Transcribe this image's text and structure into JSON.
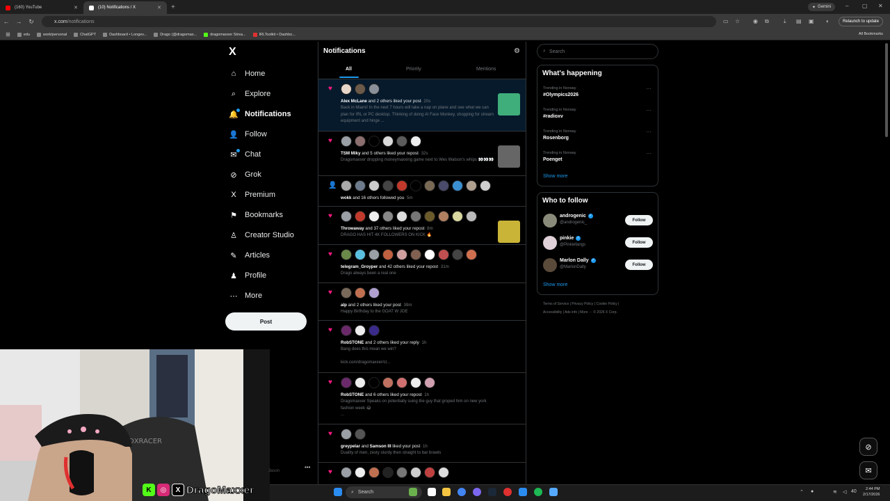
{
  "browser": {
    "tabs": [
      {
        "title": "(160) YouTube",
        "favicon_color": "#ff0000"
      },
      {
        "title": "(10) Notifications / X",
        "favicon_color": "#ffffff"
      }
    ],
    "new_tab_label": "+",
    "gemini_label": "Gemini",
    "url_domain": "x.com",
    "url_path": "/notifications",
    "relaunch_label": "Relaunch to update",
    "bookmarks": [
      "edu",
      "work/personal",
      "ChatGPT",
      "Dashboard • Longev...",
      "Drago (@dragomax...",
      "dragomaxxer Strea...",
      "IRLToolkit • Dashbo..."
    ],
    "all_bookmarks": "All Bookmarks"
  },
  "sidebar": {
    "logo": "X",
    "items": [
      {
        "label": "Home",
        "icon": "home-icon",
        "glyph": "⌂"
      },
      {
        "label": "Explore",
        "icon": "search-icon",
        "glyph": "⌕"
      },
      {
        "label": "Notifications",
        "icon": "bell-icon",
        "glyph": "🔔"
      },
      {
        "label": "Follow",
        "icon": "follow-icon",
        "glyph": "👤"
      },
      {
        "label": "Chat",
        "icon": "chat-icon",
        "glyph": "✉"
      },
      {
        "label": "Grok",
        "icon": "grok-icon",
        "glyph": "⊘"
      },
      {
        "label": "Premium",
        "icon": "x-premium-icon",
        "glyph": "X"
      },
      {
        "label": "Bookmarks",
        "icon": "bookmark-icon",
        "glyph": "⚑"
      },
      {
        "label": "Creator Studio",
        "icon": "creator-studio-icon",
        "glyph": "♙"
      },
      {
        "label": "Articles",
        "icon": "articles-icon",
        "glyph": "✎"
      },
      {
        "label": "Profile",
        "icon": "profile-icon",
        "glyph": "♟"
      },
      {
        "label": "More",
        "icon": "more-icon",
        "glyph": "⋯"
      }
    ],
    "post_label": "Post",
    "account_more": "•••"
  },
  "notifications": {
    "title": "Notifications",
    "tabs": [
      "All",
      "Priority",
      "Mentions"
    ],
    "items": [
      {
        "type": "like",
        "actor": "Alex McLane",
        "rest": " and 2 others liked your post",
        "time": "· 20s",
        "body": "Back in Miami! In the next 7 hours will take a nap on plane and see what we can plan for IRL or PC desktop. Thinking of doing AI Face Monkey, shopping for stream equipment and hinge ...",
        "avatars": [
          "#e8d6c8",
          "#6b5a4a",
          "#8a9099"
        ],
        "thumb": true,
        "thumb_color": "#3fae7a",
        "highlight": true
      },
      {
        "type": "like",
        "actor": "TSM Miky",
        "rest": " and 5 others liked your repost",
        "time": "· 32s",
        "body": "Dragomaxxer dropping moneymaxxing game next to Wes Watson's whips 👀👀👀",
        "avatars": [
          "#9aa0a6",
          "#8c6e6e",
          "#000000",
          "#d9d9d9",
          "#5c5c5c",
          "#eeeeee"
        ],
        "thumb": true,
        "thumb_color": "#666666"
      },
      {
        "type": "follow",
        "actor": "wokk",
        "rest": " and 16 others followed you",
        "time": "· 5m",
        "body": "",
        "avatars": [
          "#aaaaaa",
          "#6d7b8c",
          "#cccccc",
          "#444444",
          "#c0392b",
          "#000000",
          "#7a6a55",
          "#4a4a6a",
          "#3a8fd0",
          "#b0a090",
          "#cfcfcf"
        ],
        "thumb": false
      },
      {
        "type": "like",
        "actor": "Throwaway",
        "rest": " and 37 others liked your repost",
        "time": "· 8m",
        "body": "DRAGO HAS HIT 4K FOLLOWERS ON KICK 🔥",
        "avatars": [
          "#9aa0a6",
          "#c0392b",
          "#eeeeee",
          "#888888",
          "#dddddd",
          "#777777",
          "#6b5a2a",
          "#b08060",
          "#d8d8a0",
          "#bbbbbb"
        ],
        "thumb": true,
        "thumb_color": "#c9b437"
      },
      {
        "type": "like",
        "actor": "telegram_Groyper",
        "rest": " and 42 others liked your repost",
        "time": "· 31m",
        "body": "Drago always been a real one",
        "avatars": [
          "#6a8a4a",
          "#5ac0e0",
          "#9aa0a6",
          "#c06040",
          "#d0a0a0",
          "#806050",
          "#ffffff",
          "#c05050",
          "#444444",
          "#d07050"
        ],
        "thumb": false
      },
      {
        "type": "like",
        "actor": "alp",
        "rest": " and 2 others liked your post",
        "time": "· 39m",
        "body": "Happy Birthday to the GOAT W JOE",
        "avatars": [
          "#7a6a5a",
          "#c07050",
          "#b0a0d0"
        ],
        "thumb": false
      },
      {
        "type": "like",
        "actor": "RobSTONE",
        "rest": " and 2 others liked your reply",
        "time": "· 1h",
        "body": "Bang does this mean we win?",
        "link": "kick.com/dragomaxxer/cl...",
        "avatars": [
          "#6a2a6a",
          "#eeeeee",
          "#3a2a8a"
        ],
        "thumb": false
      },
      {
        "type": "like",
        "actor": "RobSTONE",
        "rest": " and 6 others liked your repost",
        "time": "· 1h",
        "body": "Dragomaxxer Speaks on potentially suing the guy that groped him on new york fashion week 😂",
        "extra": "...",
        "avatars": [
          "#6a2a6a",
          "#eeeeee",
          "#000000",
          "#c07060",
          "#d07070",
          "#eeeeee",
          "#d0a0b0"
        ],
        "thumb": false
      },
      {
        "type": "like",
        "actor": "greypelar",
        "mid": " and ",
        "actor2": "Samson III",
        "rest": " liked your post",
        "time": "· 1h",
        "body": "Duality of men, zesty sturdy then straight to bar brawls",
        "avatars": [
          "#9aa0a6",
          "#555555"
        ],
        "thumb": false
      },
      {
        "type": "like",
        "actor": "",
        "rest": "",
        "time": "",
        "body": "",
        "avatars": [
          "#9aa0a6",
          "#eeeeee",
          "#c07050",
          "#222222",
          "#777777",
          "#cfcfcf",
          "#c04040",
          "#dddddd"
        ],
        "thumb": false
      }
    ]
  },
  "right": {
    "search_placeholder": "Search",
    "happening_title": "What's happening",
    "trends": [
      {
        "context": "Trending in Norway",
        "name": "#Olympics2026"
      },
      {
        "context": "Trending in Norway",
        "name": "#radioxv"
      },
      {
        "context": "Trending in Norway",
        "name": "Rosenborg"
      },
      {
        "context": "Trending in Norway",
        "name": "Poenget"
      }
    ],
    "show_more": "Show more",
    "who_title": "Who to follow",
    "who": [
      {
        "name": "androgenic",
        "handle": "@androgenic_",
        "avatar_color": "#8a8a7a"
      },
      {
        "name": "pinkie",
        "handle": "@Pinkiefangs",
        "avatar_color": "#e0d0d8"
      },
      {
        "name": "Marlon Dally",
        "handle": "@MarlonDally",
        "avatar_color": "#5a4a3a"
      }
    ],
    "follow_label": "Follow",
    "footer_line1": "Terms of Service  |  Privacy Policy  |  Cookie Policy  |",
    "footer_line2": "Accessibility  |  Ads info  |  More ···  © 2026 X Corp."
  },
  "overlay": {
    "brand_text": "DragoMaxxer",
    "kick_glyph": "K",
    "ig_glyph": "◎",
    "x_glyph": "X",
    "stray_text": "Jason"
  },
  "taskbar": {
    "search_label": "Search",
    "time": "2:44 PM",
    "date": "2/17/2026",
    "tray_text": "40"
  },
  "colors": {
    "accent": "#1d9bf0",
    "like": "#f91880",
    "background": "#000000",
    "border": "#2f3336"
  }
}
